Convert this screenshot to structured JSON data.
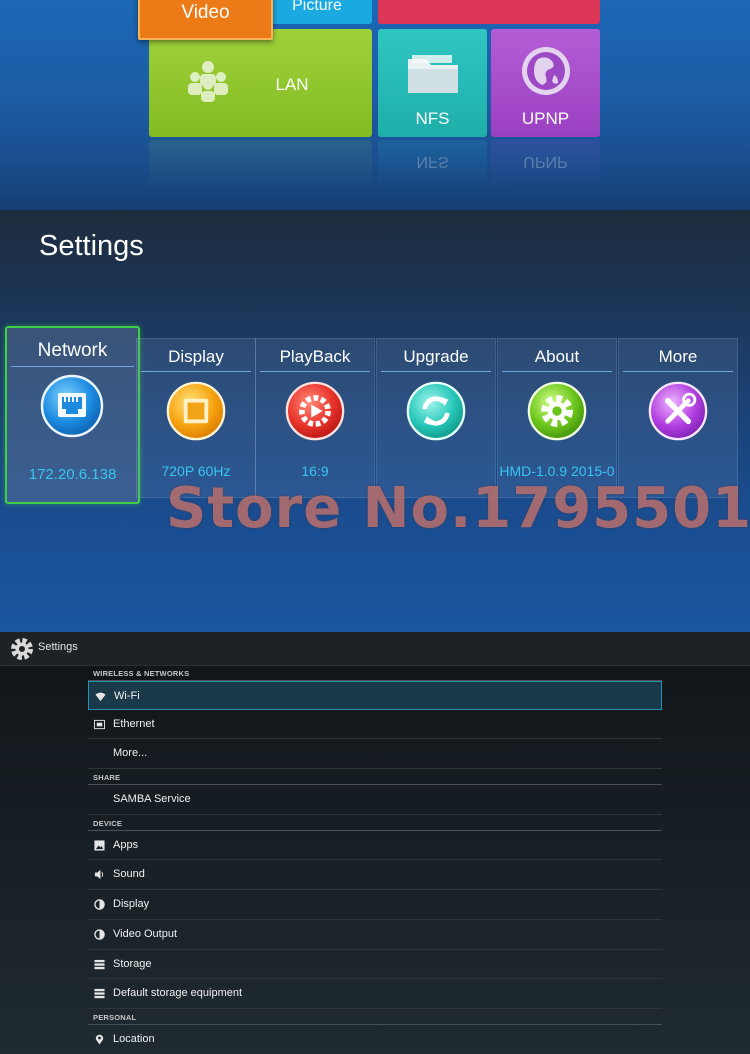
{
  "media": {
    "video_label": "Video",
    "picture_label": "Picture",
    "lan_label": "LAN",
    "nfs_label": "NFS",
    "upnp_label": "UPNP",
    "nfs_reflection": "NFS",
    "upnp_reflection": "UPNP"
  },
  "launcher": {
    "title": "Settings",
    "cards": [
      {
        "title": "Network",
        "value": "172.20.6.138",
        "icon": "network-icon"
      },
      {
        "title": "Display",
        "value": "720P 60Hz",
        "icon": "display-icon"
      },
      {
        "title": "PlayBack",
        "value": "16:9",
        "icon": "playback-icon"
      },
      {
        "title": "Upgrade",
        "value": "",
        "icon": "upgrade-icon"
      },
      {
        "title": "About",
        "value": "HMD-1.0.9 2015-0",
        "icon": "about-gear-icon"
      },
      {
        "title": "More",
        "value": "",
        "icon": "tools-icon"
      }
    ],
    "watermark": "Store No.1795501"
  },
  "android": {
    "title": "Settings",
    "sections": [
      {
        "header": "WIRELESS & NETWORKS",
        "items": [
          "Wi-Fi",
          "Ethernet",
          "More..."
        ]
      },
      {
        "header": "SHARE",
        "items": [
          "SAMBA Service"
        ]
      },
      {
        "header": "DEVICE",
        "items": [
          "Apps",
          "Sound",
          "Display",
          "Video Output",
          "Storage",
          "Default storage equipment"
        ]
      },
      {
        "header": "PERSONAL",
        "items": [
          "Location"
        ]
      }
    ]
  },
  "colors": {
    "selected_border": "#3fcf48",
    "value_text": "#39c4ef",
    "lan_tile": "#8fc42c",
    "video_tile": "#ec7a16"
  }
}
